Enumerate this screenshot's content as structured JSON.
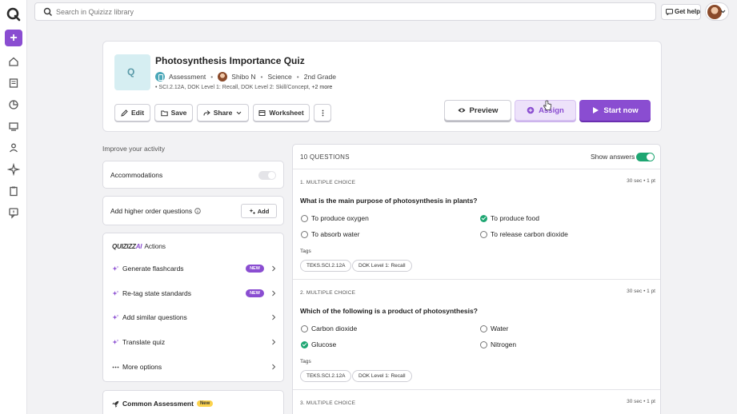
{
  "topbar": {
    "search_placeholder": "Search in Quizizz library",
    "help_label": "Get help"
  },
  "quiz": {
    "thumb_letter": "Q",
    "title": "Photosynthesis Importance Quiz",
    "type": "Assessment",
    "author": "Shibo N",
    "subject": "Science",
    "grade": "2nd Grade",
    "standards": "SCI.2.12A, DOK Level 1: Recall, DOK Level 2: Skill/Concept,",
    "standards_more": "+2 more",
    "actions": {
      "edit": "Edit",
      "save": "Save",
      "share": "Share",
      "worksheet": "Worksheet",
      "preview": "Preview",
      "assign": "Assign",
      "start": "Start now"
    }
  },
  "improve": {
    "heading": "Improve your activity",
    "accommodations": "Accommodations",
    "higher_order": "Higher order questions",
    "higher_order_label": "Add higher order questions",
    "add_label": "Add",
    "ai_brand": "QUIZIZZ",
    "ai_brand_suffix": "AI",
    "ai_actions_label": "Actions",
    "ai_items": [
      {
        "label": "Generate flashcards",
        "badge": "NEW"
      },
      {
        "label": "Re-tag state standards",
        "badge": "NEW"
      },
      {
        "label": "Add similar questions",
        "badge": ""
      },
      {
        "label": "Translate quiz",
        "badge": ""
      },
      {
        "label": "More options",
        "badge": ""
      }
    ],
    "common_assessment": "Common Assessment",
    "common_assessment_badge": "New"
  },
  "questions": {
    "count_label": "10 QUESTIONS",
    "show_answers_label": "Show answers",
    "show_answers_on": true,
    "tags_label": "Tags",
    "items": [
      {
        "type": "1. MULTIPLE CHOICE",
        "meta": "30 sec  •  1 pt",
        "text": "What is the main purpose of photosynthesis in plants?",
        "options": [
          {
            "label": "To produce oxygen",
            "correct": false
          },
          {
            "label": "To produce food",
            "correct": true
          },
          {
            "label": "To absorb water",
            "correct": false
          },
          {
            "label": "To release carbon dioxide",
            "correct": false
          }
        ],
        "tags": [
          "TEKS.SCI.2.12A",
          "DOK Level 1: Recall"
        ]
      },
      {
        "type": "2. MULTIPLE CHOICE",
        "meta": "30 sec  •  1 pt",
        "text": "Which of the following is a product of photosynthesis?",
        "options": [
          {
            "label": "Carbon dioxide",
            "correct": false
          },
          {
            "label": "Water",
            "correct": false
          },
          {
            "label": "Glucose",
            "correct": true
          },
          {
            "label": "Nitrogen",
            "correct": false
          }
        ],
        "tags": [
          "TEKS.SCI.2.12A",
          "DOK Level 1: Recall"
        ]
      },
      {
        "type": "3. MULTIPLE CHOICE",
        "meta": "30 sec  •  1 pt"
      }
    ]
  },
  "colors": {
    "accent": "#8a4dd1",
    "success": "#1ea672"
  }
}
